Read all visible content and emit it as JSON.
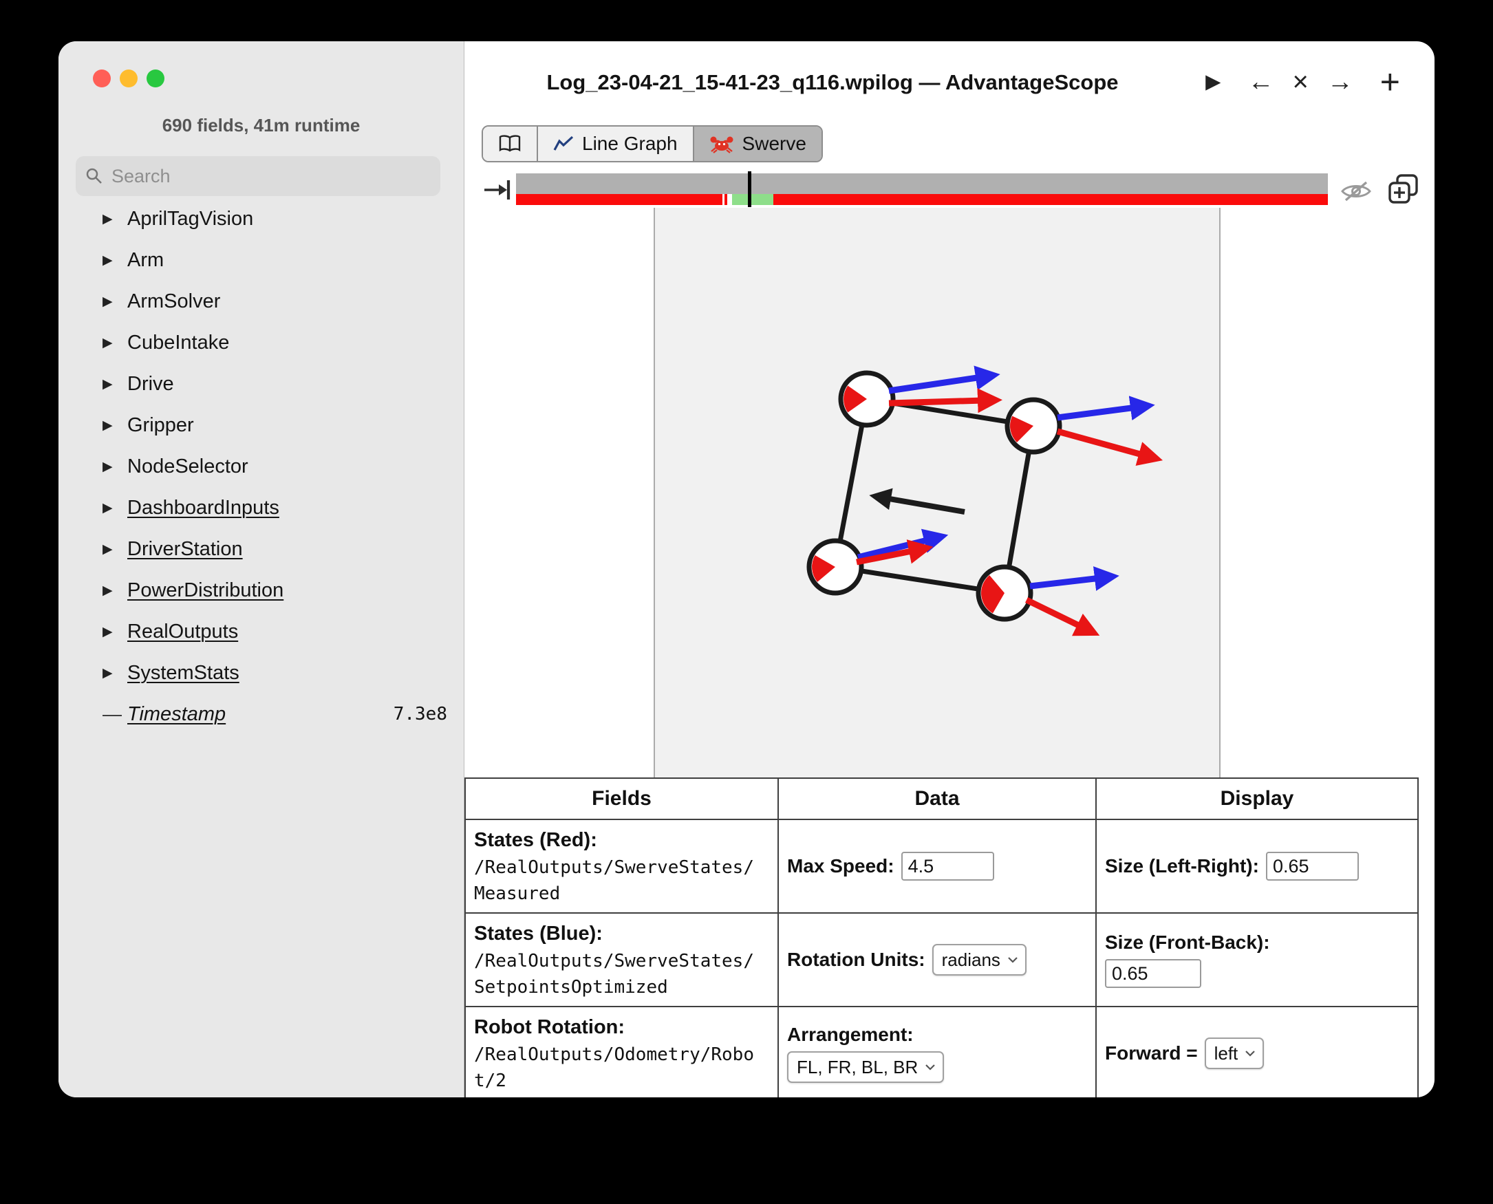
{
  "window": {
    "title": "Log_23-04-21_15-41-23_q116.wpilog — AdvantageScope"
  },
  "icons": {
    "expand": "▶",
    "dash": "—",
    "play": "▶",
    "back": "←",
    "close": "×",
    "forward": "→",
    "add": "+"
  },
  "sidebar": {
    "summary": "690 fields, 41m runtime",
    "search_placeholder": "Search",
    "items": [
      {
        "label": "AprilTagVision"
      },
      {
        "label": "Arm"
      },
      {
        "label": "ArmSolver"
      },
      {
        "label": "CubeIntake"
      },
      {
        "label": "Drive"
      },
      {
        "label": "Gripper"
      },
      {
        "label": "NodeSelector"
      },
      {
        "label": "DashboardInputs",
        "underlined": true
      },
      {
        "label": "DriverStation",
        "underlined": true
      },
      {
        "label": "PowerDistribution",
        "underlined": true
      },
      {
        "label": "RealOutputs",
        "underlined": true
      },
      {
        "label": "SystemStats",
        "underlined": true
      },
      {
        "label": "Timestamp",
        "underlined": true,
        "italic": true,
        "value": "7.3e8"
      }
    ]
  },
  "tabs": [
    {
      "icon": "book-icon",
      "label": ""
    },
    {
      "icon": "line-graph-icon",
      "label": "Line Graph"
    },
    {
      "icon": "crab-icon",
      "label": "Swerve",
      "selected": true
    }
  ],
  "timeline": {
    "playhead_fraction": 0.286,
    "gap_start_fraction": 0.254,
    "gap_end_fraction": 0.266,
    "tick_fraction": 0.257,
    "green_start_fraction": 0.266,
    "green_end_fraction": 0.317
  },
  "table": {
    "headers": [
      "Fields",
      "Data",
      "Display"
    ],
    "fields": {
      "red_label": "States (Red):",
      "red_path_1": "/RealOutputs/SwerveStates/",
      "red_path_2": "Measured",
      "blue_label": "States (Blue):",
      "blue_path_1": "/RealOutputs/SwerveStates/",
      "blue_path_2": "SetpointsOptimized",
      "rotation_label": "Robot Rotation:",
      "rotation_path_1": "/RealOutputs/Odometry/Robo",
      "rotation_path_2": "t/2"
    },
    "data": {
      "max_speed_label": "Max Speed:",
      "max_speed_value": "4.5",
      "rotation_units_label": "Rotation Units:",
      "rotation_units_value": "radians",
      "arrangement_label": "Arrangement:",
      "arrangement_value": "FL, FR, BL, BR"
    },
    "display": {
      "size_lr_label": "Size (Left-Right):",
      "size_lr_value": "0.65",
      "size_fb_label": "Size (Front-Back):",
      "size_fb_value": "0.65",
      "forward_label": "Forward =",
      "forward_value": "left"
    }
  }
}
